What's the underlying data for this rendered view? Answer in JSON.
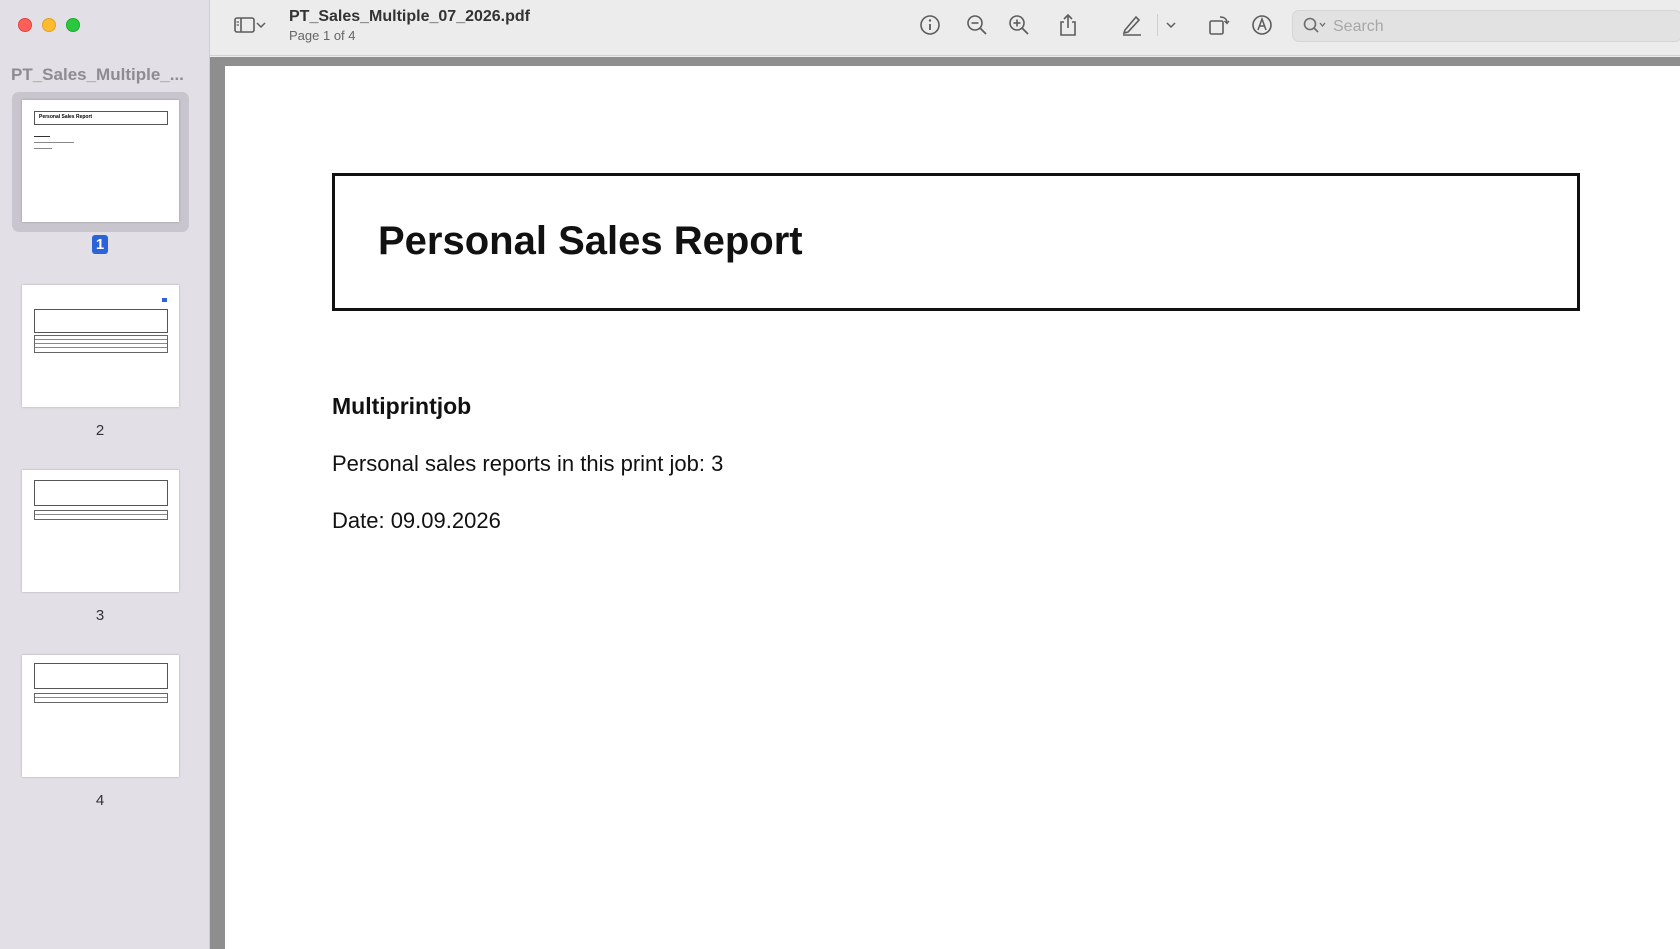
{
  "window": {
    "file_name": "PT_Sales_Multiple_07_2026.pdf",
    "page_indicator": "Page 1 of 4"
  },
  "sidebar": {
    "title": "PT_Sales_Multiple_...",
    "thumbnails": [
      {
        "number": "1",
        "selected": true,
        "mini_title": "Personal Sales Report"
      },
      {
        "number": "2",
        "selected": false
      },
      {
        "number": "3",
        "selected": false
      },
      {
        "number": "4",
        "selected": false
      }
    ]
  },
  "toolbar": {
    "search_placeholder": "Search",
    "icons": [
      "sidebar-toggle-icon",
      "chevron-down-icon",
      "info-icon",
      "zoom-out-icon",
      "zoom-in-icon",
      "share-icon",
      "highlight-pen-icon",
      "chevron-down-icon",
      "rotate-icon",
      "markup-icon",
      "search-icon"
    ]
  },
  "document": {
    "report_title": "Personal Sales Report",
    "section_heading": "Multiprintjob",
    "reports_count_line": "Personal sales reports in this print job: 3",
    "date_line": "Date: 09.09.2026"
  },
  "colors": {
    "sidebar_bg": "#e3dfe6",
    "selection_badge": "#2b63d9",
    "toolbar_bg": "#ececec"
  }
}
